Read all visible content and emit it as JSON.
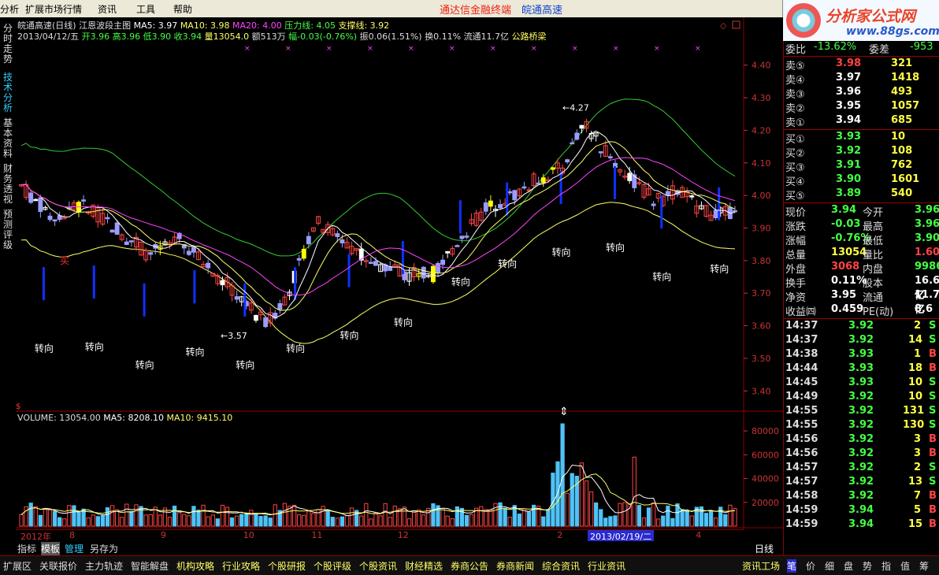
{
  "menu": {
    "items": [
      "分析",
      "扩展市场行情",
      "资讯",
      "工具",
      "帮助"
    ],
    "ad_text": "通达信金融终端",
    "stock_name": "皖通高速"
  },
  "logo": {
    "title": "分析家公式网",
    "url_text": "www.88gs.com"
  },
  "left_tabs": [
    "分时走势",
    "技术分析",
    "基本资料",
    "财务透视",
    "预测评级"
  ],
  "info": {
    "line1": [
      {
        "text": "皖通高速(日线) 江恩波段主图",
        "color": "#dddddd"
      },
      {
        "text": "MA5: 3.97",
        "color": "#ffffff"
      },
      {
        "text": "MA10: 3.98",
        "color": "#ffff66"
      },
      {
        "text": "MA20: 4.00",
        "color": "#ff44ff"
      },
      {
        "text": "压力线: 4.05",
        "color": "#44ff44"
      },
      {
        "text": "支撑线: 3.92",
        "color": "#ffff66"
      }
    ],
    "line2": [
      {
        "text": "2013/04/12/五",
        "color": "#dddddd"
      },
      {
        "text": "开3.96",
        "color": "#44ff44"
      },
      {
        "text": "高3.96",
        "color": "#44ff44"
      },
      {
        "text": "低3.90",
        "color": "#44ff44"
      },
      {
        "text": "收3.94",
        "color": "#44ff44"
      },
      {
        "text": "量13054.0",
        "color": "#ffff66"
      },
      {
        "text": "额513万",
        "color": "#dddddd"
      },
      {
        "text": "幅-0.03(-0.76%)",
        "color": "#44ff44"
      },
      {
        "text": "振0.06(1.51%)",
        "color": "#dddddd"
      },
      {
        "text": "换0.11%",
        "color": "#dddddd"
      },
      {
        "text": "流通11.7亿",
        "color": "#dddddd"
      },
      {
        "text": "公路桥梁",
        "color": "#ffff66"
      }
    ]
  },
  "chart_data": [
    {
      "type": "candlestick",
      "y_ticks": [
        "4.40",
        "4.30",
        "4.20",
        "4.10",
        "4.00",
        "3.90",
        "3.80",
        "3.70",
        "3.60",
        "3.50",
        "3.40"
      ],
      "ylim": [
        3.35,
        4.45
      ],
      "annotations": [
        {
          "label": "转向",
          "x": 0.035,
          "y": 3.52
        },
        {
          "label": "转向",
          "x": 0.105,
          "y": 3.525
        },
        {
          "label": "转向",
          "x": 0.175,
          "y": 3.47
        },
        {
          "label": "转向",
          "x": 0.245,
          "y": 3.51
        },
        {
          "label": "转向",
          "x": 0.315,
          "y": 3.47
        },
        {
          "label": "转向",
          "x": 0.385,
          "y": 3.52
        },
        {
          "label": "转向",
          "x": 0.46,
          "y": 3.56
        },
        {
          "label": "转向",
          "x": 0.535,
          "y": 3.6
        },
        {
          "label": "转向",
          "x": 0.615,
          "y": 3.725
        },
        {
          "label": "转向",
          "x": 0.68,
          "y": 3.78
        },
        {
          "label": "转向",
          "x": 0.755,
          "y": 3.815
        },
        {
          "label": "转向",
          "x": 0.83,
          "y": 3.83
        },
        {
          "label": "转向",
          "x": 0.895,
          "y": 3.74
        },
        {
          "label": "转向",
          "x": 0.975,
          "y": 3.765
        }
      ],
      "price_labels": [
        "4.27",
        "3.57"
      ],
      "buy_label": "买"
    },
    {
      "type": "bar",
      "title": "VOLUME: 13054.00",
      "ma5_label": "MA5: 8208.10",
      "ma10_label": "MA10: 9415.10",
      "y_ticks": [
        "80000",
        "60000",
        "40000",
        "20000"
      ],
      "ylim": [
        0,
        90000
      ]
    }
  ],
  "x_axis": {
    "labels": [
      {
        "text": "2012年",
        "x": 0.0
      },
      {
        "text": "8",
        "x": 0.068
      },
      {
        "text": "9",
        "x": 0.195
      },
      {
        "text": "10",
        "x": 0.31
      },
      {
        "text": "11",
        "x": 0.405
      },
      {
        "text": "12",
        "x": 0.525
      },
      {
        "text": "2",
        "x": 0.747
      },
      {
        "text": "3",
        "x": 0.85
      },
      {
        "text": "4",
        "x": 0.94
      }
    ],
    "highlight": "2013/02/19/二",
    "period": "日线"
  },
  "quote": {
    "header": [
      {
        "label": "委比",
        "value": "-13.62%"
      },
      {
        "label": "委差",
        "value": "-953"
      }
    ],
    "sell": [
      {
        "label": "卖⑤",
        "price": "3.98",
        "vol": "321",
        "color": "#ff4444"
      },
      {
        "label": "卖④",
        "price": "3.97",
        "vol": "1418",
        "color": "#ffffff"
      },
      {
        "label": "卖③",
        "price": "3.96",
        "vol": "493",
        "color": "#ffffff"
      },
      {
        "label": "卖②",
        "price": "3.95",
        "vol": "1057",
        "color": "#ffffff"
      },
      {
        "label": "卖①",
        "price": "3.94",
        "vol": "685",
        "color": "#ffffff"
      }
    ],
    "buy": [
      {
        "label": "买①",
        "price": "3.93",
        "vol": "10",
        "color": "#44ff44"
      },
      {
        "label": "买②",
        "price": "3.92",
        "vol": "108",
        "color": "#44ff44"
      },
      {
        "label": "买③",
        "price": "3.91",
        "vol": "762",
        "color": "#44ff44"
      },
      {
        "label": "买④",
        "price": "3.90",
        "vol": "1601",
        "color": "#44ff44"
      },
      {
        "label": "买⑤",
        "price": "3.89",
        "vol": "540",
        "color": "#44ff44"
      }
    ],
    "stats": [
      {
        "l1": "现价",
        "v1": "3.94",
        "c1": "#44ff44",
        "l2": "今开",
        "v2": "3.96",
        "c2": "#44ff44"
      },
      {
        "l1": "涨跌",
        "v1": "-0.03",
        "c1": "#44ff44",
        "l2": "最高",
        "v2": "3.96",
        "c2": "#44ff44"
      },
      {
        "l1": "涨幅",
        "v1": "-0.76%",
        "c1": "#44ff44",
        "l2": "最低",
        "v2": "3.90",
        "c2": "#44ff44"
      },
      {
        "l1": "总量",
        "v1": "13054",
        "c1": "#ffff44",
        "l2": "量比",
        "v2": "1.60",
        "c2": "#ff4444"
      },
      {
        "l1": "外盘",
        "v1": "3068",
        "c1": "#ff4444",
        "l2": "内盘",
        "v2": "9986",
        "c2": "#44ff44"
      },
      {
        "l1": "换手",
        "v1": "0.11%",
        "c1": "#ffffff",
        "l2": "股本",
        "v2": "16.6亿",
        "c2": "#ffffff"
      },
      {
        "l1": "净资",
        "v1": "3.95",
        "c1": "#ffffff",
        "l2": "流通",
        "v2": "11.7亿",
        "c2": "#ffffff"
      },
      {
        "l1": "收益㈣",
        "v1": "0.459",
        "c1": "#ffffff",
        "l2": "PE(动)",
        "v2": "8.6",
        "c2": "#ffffff"
      }
    ],
    "ticks": [
      {
        "t": "14:37",
        "p": "3.92",
        "v": "2",
        "s": "S"
      },
      {
        "t": "14:37",
        "p": "3.92",
        "v": "14",
        "s": "S"
      },
      {
        "t": "14:38",
        "p": "3.93",
        "v": "1",
        "s": "B"
      },
      {
        "t": "14:44",
        "p": "3.93",
        "v": "18",
        "s": "B"
      },
      {
        "t": "14:45",
        "p": "3.93",
        "v": "10",
        "s": "S"
      },
      {
        "t": "14:49",
        "p": "3.92",
        "v": "10",
        "s": "S"
      },
      {
        "t": "14:55",
        "p": "3.92",
        "v": "131",
        "s": "S"
      },
      {
        "t": "14:55",
        "p": "3.92",
        "v": "130",
        "s": "S"
      },
      {
        "t": "14:56",
        "p": "3.92",
        "v": "3",
        "s": "B"
      },
      {
        "t": "14:56",
        "p": "3.92",
        "v": "3",
        "s": "B"
      },
      {
        "t": "14:57",
        "p": "3.92",
        "v": "2",
        "s": "S"
      },
      {
        "t": "14:57",
        "p": "3.92",
        "v": "13",
        "s": "S"
      },
      {
        "t": "14:58",
        "p": "3.92",
        "v": "7",
        "s": "B"
      },
      {
        "t": "14:59",
        "p": "3.94",
        "v": "5",
        "s": "B"
      },
      {
        "t": "14:59",
        "p": "3.94",
        "v": "15",
        "s": "B"
      }
    ]
  },
  "chart_tabs": [
    "指标",
    "模板",
    "管理",
    "另存为"
  ],
  "status": {
    "items": [
      "扩展区",
      "关联报价",
      "主力轨迹",
      "智能解盘",
      "机构攻略",
      "行业攻略",
      "个股研报",
      "个股评级",
      "个股资讯",
      "财经精选",
      "券商公告",
      "券商新闻",
      "综合资讯",
      "行业资讯"
    ],
    "right": "资讯工场",
    "right_tabs": [
      "笔",
      "价",
      "细",
      "盘",
      "势",
      "指",
      "值",
      "筹"
    ]
  },
  "colors": {
    "up": "#ff4444",
    "down": "#4fc3f7",
    "ma5": "#ffffff",
    "ma10": "#ffff66",
    "ma20": "#ff44ff",
    "resist": "#33cc33",
    "support": "#ffff66",
    "turn": "#1030ff"
  }
}
